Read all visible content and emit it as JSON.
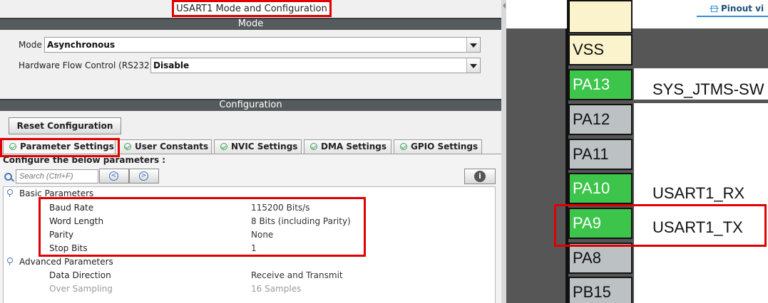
{
  "dialog": {
    "title": "USART1 Mode and Configuration"
  },
  "mode_section": {
    "header": "Mode",
    "mode_label": "Mode",
    "mode_value": "Asynchronous",
    "flow_label": "Hardware Flow Control (RS232)",
    "flow_value": "Disable"
  },
  "config_section": {
    "header": "Configuration",
    "reset_label": "Reset Configuration",
    "tabs": [
      {
        "label": "Parameter Settings"
      },
      {
        "label": "User Constants"
      },
      {
        "label": "NVIC Settings"
      },
      {
        "label": "DMA Settings"
      },
      {
        "label": "GPIO Settings"
      }
    ],
    "caption": "Configure the below parameters :",
    "search_placeholder": "Search (Ctrl+F)",
    "basic_group": "Basic Parameters",
    "basic_params": [
      {
        "name": "Baud Rate",
        "value": "115200 Bits/s"
      },
      {
        "name": "Word Length",
        "value": "8 Bits (including Parity)"
      },
      {
        "name": "Parity",
        "value": "None"
      },
      {
        "name": "Stop Bits",
        "value": "1"
      }
    ],
    "advanced_group": "Advanced Parameters",
    "advanced_params": [
      {
        "name": "Data Direction",
        "value": "Receive and Transmit"
      },
      {
        "name": "Over Sampling",
        "value": "16 Samples"
      }
    ]
  },
  "pinout": {
    "view_label": "Pinout vi",
    "pins": [
      {
        "name": "VSS",
        "signal": "",
        "color": "#fbf3cc"
      },
      {
        "name": "PA13",
        "signal": "SYS_JTMS-SW",
        "color": "#3cc54a"
      },
      {
        "name": "PA12",
        "signal": "",
        "color": "#bcc1c4"
      },
      {
        "name": "PA11",
        "signal": "",
        "color": "#bcc1c4"
      },
      {
        "name": "PA10",
        "signal": "USART1_RX",
        "color": "#3cc54a"
      },
      {
        "name": "PA9",
        "signal": "USART1_TX",
        "color": "#3cc54a"
      },
      {
        "name": "PA8",
        "signal": "",
        "color": "#bcc1c4"
      },
      {
        "name": "PB15",
        "signal": "",
        "color": "#bcc1c4"
      }
    ]
  }
}
